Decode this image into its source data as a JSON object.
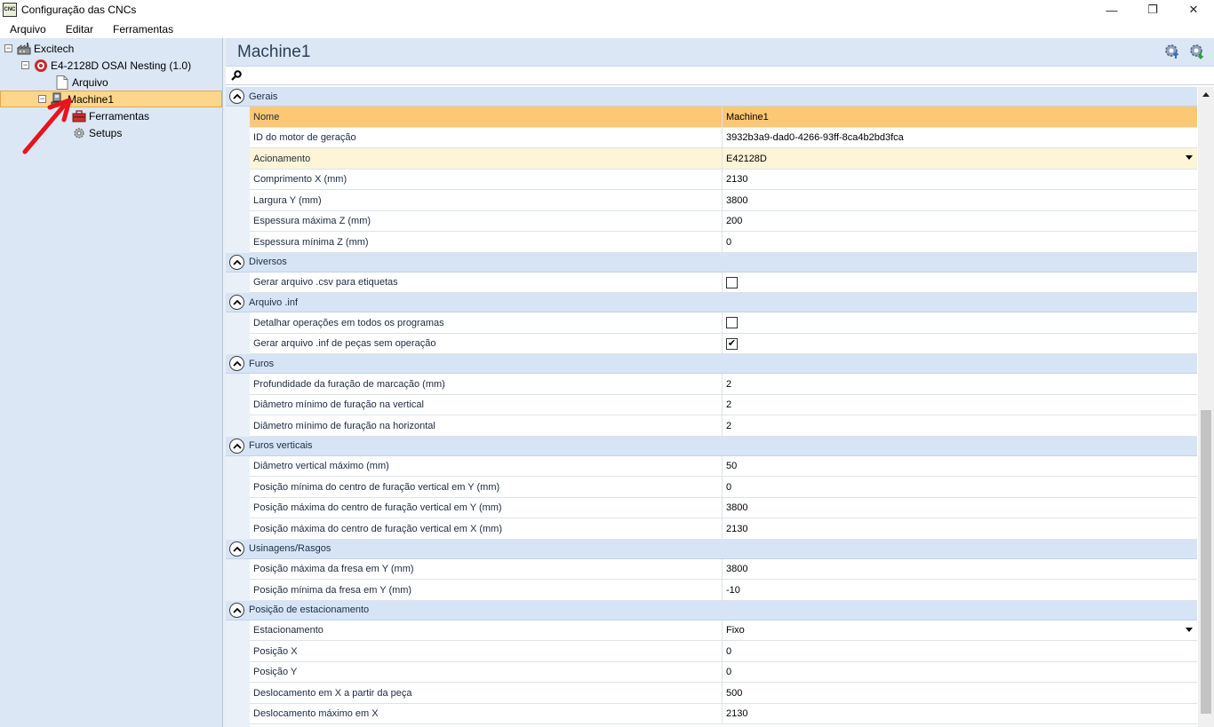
{
  "window": {
    "title": "Configuração das CNCs",
    "app_icon_label": "CNC",
    "controls": {
      "minimize": "—",
      "maximize": "❐",
      "close": "✕"
    }
  },
  "menu": {
    "items": [
      "Arquivo",
      "Editar",
      "Ferramentas"
    ]
  },
  "tree": {
    "root": "Excitech",
    "cnc": "E4-2128D OSAI Nesting (1.0)",
    "arquivo": "Arquivo",
    "machine": "Machine1",
    "ferramentas": "Ferramentas",
    "setups": "Setups",
    "expander_symbol": "−"
  },
  "panel": {
    "title": "Machine1",
    "search": {
      "value": "",
      "placeholder": ""
    }
  },
  "sections": [
    {
      "label": "Gerais",
      "rows": [
        {
          "name": "Nome",
          "value": "Machine1",
          "state": "highlight"
        },
        {
          "name": "ID do motor de geração",
          "value": "3932b3a9-dad0-4266-93ff-8ca4b2bd3fca"
        },
        {
          "name": "Acionamento",
          "value": "E42128D",
          "state": "edited",
          "dropdown": true
        },
        {
          "name": "Comprimento X (mm)",
          "value": "2130"
        },
        {
          "name": "Largura Y (mm)",
          "value": "3800"
        },
        {
          "name": "Espessura máxima Z (mm)",
          "value": "200"
        },
        {
          "name": "Espessura mínima Z (mm)",
          "value": "0"
        }
      ]
    },
    {
      "label": "Diversos",
      "rows": [
        {
          "name": "Gerar arquivo .csv para etiquetas",
          "checkbox": false
        }
      ]
    },
    {
      "label": "Arquivo .inf",
      "rows": [
        {
          "name": "Detalhar operações em todos os programas",
          "checkbox": false
        },
        {
          "name": "Gerar arquivo .inf de peças sem operação",
          "checkbox": true
        }
      ]
    },
    {
      "label": "Furos",
      "rows": [
        {
          "name": "Profundidade da furação de marcação (mm)",
          "value": "2"
        },
        {
          "name": "Diâmetro mínimo de furação na vertical",
          "value": "2"
        },
        {
          "name": "Diâmetro mínimo de furação na horizontal",
          "value": "2"
        }
      ]
    },
    {
      "label": "Furos verticais",
      "rows": [
        {
          "name": "Diâmetro vertical máximo (mm)",
          "value": "50"
        },
        {
          "name": "Posição mínima do centro de furação vertical em Y (mm)",
          "value": "0"
        },
        {
          "name": "Posição máxima do centro de furação vertical em Y (mm)",
          "value": "3800"
        },
        {
          "name": "Posição máxima do centro de furação vertical em X (mm)",
          "value": "2130"
        }
      ]
    },
    {
      "label": "Usinagens/Rasgos",
      "rows": [
        {
          "name": "Posição máxima da fresa em Y (mm)",
          "value": "3800"
        },
        {
          "name": "Posição mínima da fresa em Y (mm)",
          "value": "-10"
        }
      ]
    },
    {
      "label": "Posição de estacionamento",
      "rows": [
        {
          "name": "Estacionamento",
          "value": "Fixo",
          "dropdown": true
        },
        {
          "name": "Posição X",
          "value": "0"
        },
        {
          "name": "Posição Y",
          "value": "0"
        },
        {
          "name": "Deslocamento em X a partir da peça",
          "value": "500"
        },
        {
          "name": "Deslocamento máximo em X",
          "value": "2130"
        }
      ]
    }
  ],
  "colors": {
    "selected_row": "#fbc874",
    "edited_row": "#fef5d8",
    "section_bg": "#d6e4f5",
    "annotation": "#e8141b"
  },
  "icons": {
    "collapse": "chevron-up-icon",
    "search": "search-icon",
    "header_left": "settings-upload-icon",
    "header_right": "settings-download-icon"
  }
}
